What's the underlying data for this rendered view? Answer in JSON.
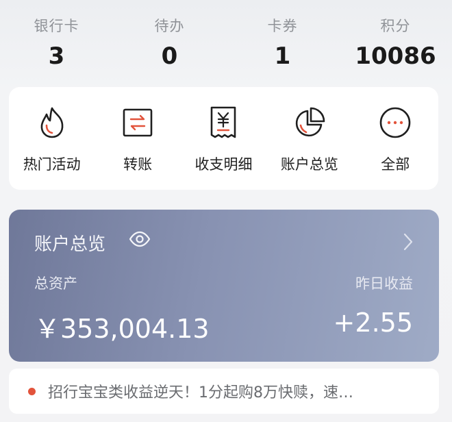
{
  "stats": [
    {
      "label": "银行卡",
      "value": "3"
    },
    {
      "label": "待办",
      "value": "0"
    },
    {
      "label": "卡券",
      "value": "1"
    },
    {
      "label": "积分",
      "value": "10086"
    }
  ],
  "quick_actions": [
    {
      "label": "热门活动",
      "icon": "flame-icon"
    },
    {
      "label": "转账",
      "icon": "transfer-icon"
    },
    {
      "label": "收支明细",
      "icon": "receipt-icon"
    },
    {
      "label": "账户总览",
      "icon": "pie-chart-icon"
    },
    {
      "label": "全部",
      "icon": "more-icon"
    }
  ],
  "overview": {
    "title": "账户总览",
    "total_assets_label": "总资产",
    "total_assets": "￥353,004.13",
    "yesterday_label": "昨日收益",
    "yesterday_value": "+2.55"
  },
  "notice": {
    "text": "招行宝宝类收益逆天！1分起购8万快赎，速…"
  },
  "colors": {
    "accent_red": "#e2533b",
    "card_gradient_start": "#6f7899",
    "card_gradient_end": "#9fabc6"
  }
}
